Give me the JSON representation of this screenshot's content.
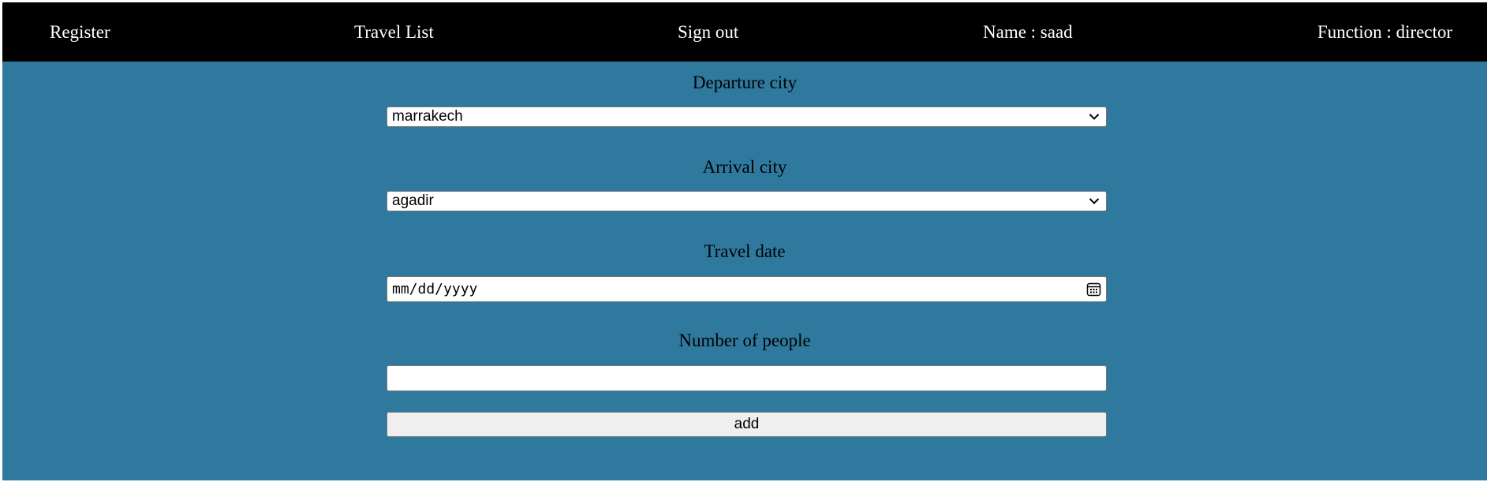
{
  "nav": {
    "register": "Register",
    "travel_list": "Travel List",
    "sign_out": "Sign out",
    "name": "Name : saad",
    "function": "Function : director"
  },
  "form": {
    "departure_label": "Departure city",
    "departure_value": "marrakech",
    "arrival_label": "Arrival city",
    "arrival_value": "agadir",
    "date_label": "Travel date",
    "date_placeholder": "mm/dd/yyyy",
    "people_label": "Number of people",
    "people_value": "",
    "add_label": "add"
  },
  "colors": {
    "navbar": "#000000",
    "page_background": "#2f799f",
    "button_background": "#efefef"
  },
  "icons": {
    "select_arrow": "chevron-down-icon",
    "date_picker": "calendar-icon"
  }
}
